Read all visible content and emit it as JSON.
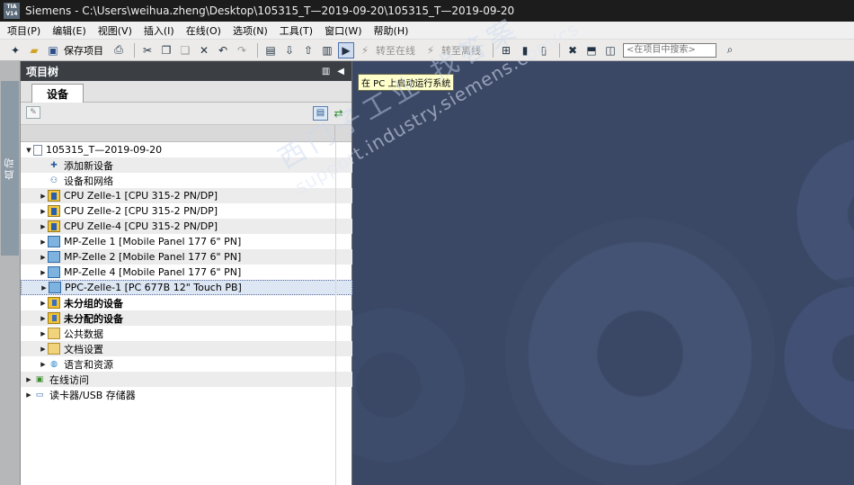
{
  "window": {
    "logo_text": "TIA V14",
    "title": "Siemens  -  C:\\Users\\weihua.zheng\\Desktop\\105315_T—2019-09-20\\105315_T—2019-09-20"
  },
  "menu": [
    "项目(P)",
    "编辑(E)",
    "视图(V)",
    "插入(I)",
    "在线(O)",
    "选项(N)",
    "工具(T)",
    "窗口(W)",
    "帮助(H)"
  ],
  "toolbar": {
    "save_label": "保存项目",
    "go_online_label": "转至在线",
    "go_offline_label": "转至离线",
    "search_placeholder": "<在项目中搜索>"
  },
  "rail": {
    "portal_label": "启动"
  },
  "project_tree": {
    "header": "项目树",
    "tab": "设备",
    "rows": [
      {
        "label": "105315_T—2019-09-20",
        "icon": "document-icon",
        "indent": 0,
        "expanded": true
      },
      {
        "label": "添加新设备",
        "icon": "add-device-icon",
        "indent": 1,
        "leaf": true
      },
      {
        "label": "设备和网络",
        "icon": "network-icon",
        "indent": 1,
        "leaf": true
      },
      {
        "label": "CPU Zelle-1 [CPU 315-2 PN/DP]",
        "icon": "cpu-icon",
        "indent": 1
      },
      {
        "label": "CPU Zelle-2 [CPU 315-2 PN/DP]",
        "icon": "cpu-icon",
        "indent": 1
      },
      {
        "label": "CPU Zelle-4 [CPU 315-2 PN/DP]",
        "icon": "cpu-icon",
        "indent": 1
      },
      {
        "label": "MP-Zelle 1 [Mobile Panel 177 6\" PN]",
        "icon": "hmi-icon",
        "indent": 1
      },
      {
        "label": "MP-Zelle 2 [Mobile Panel 177 6\" PN]",
        "icon": "hmi-icon",
        "indent": 1
      },
      {
        "label": "MP-Zelle 4 [Mobile Panel 177 6\" PN]",
        "icon": "hmi-icon",
        "indent": 1
      },
      {
        "label": "PPC-Zelle-1 [PC 677B 12\" Touch PB]",
        "icon": "pc-icon",
        "indent": 1,
        "selected": true
      },
      {
        "label": "未分组的设备",
        "icon": "ungrouped-devices-icon",
        "indent": 1,
        "bold": true
      },
      {
        "label": "未分配的设备",
        "icon": "unassigned-devices-icon",
        "indent": 1,
        "bold": true
      },
      {
        "label": "公共数据",
        "icon": "common-data-icon",
        "indent": 1
      },
      {
        "label": "文档设置",
        "icon": "document-settings-icon",
        "indent": 1
      },
      {
        "label": "语言和资源",
        "icon": "language-icon",
        "indent": 1
      },
      {
        "label": "在线访问",
        "icon": "online-access-icon",
        "indent": 0
      },
      {
        "label": "读卡器/USB 存储器",
        "icon": "card-reader-icon",
        "indent": 0
      }
    ]
  },
  "canvas": {
    "tooltip": "在 PC 上启动运行系统"
  },
  "watermark": {
    "line1": "西门子工业   找答案",
    "line2": "support.industry.siemens.com/cs"
  }
}
